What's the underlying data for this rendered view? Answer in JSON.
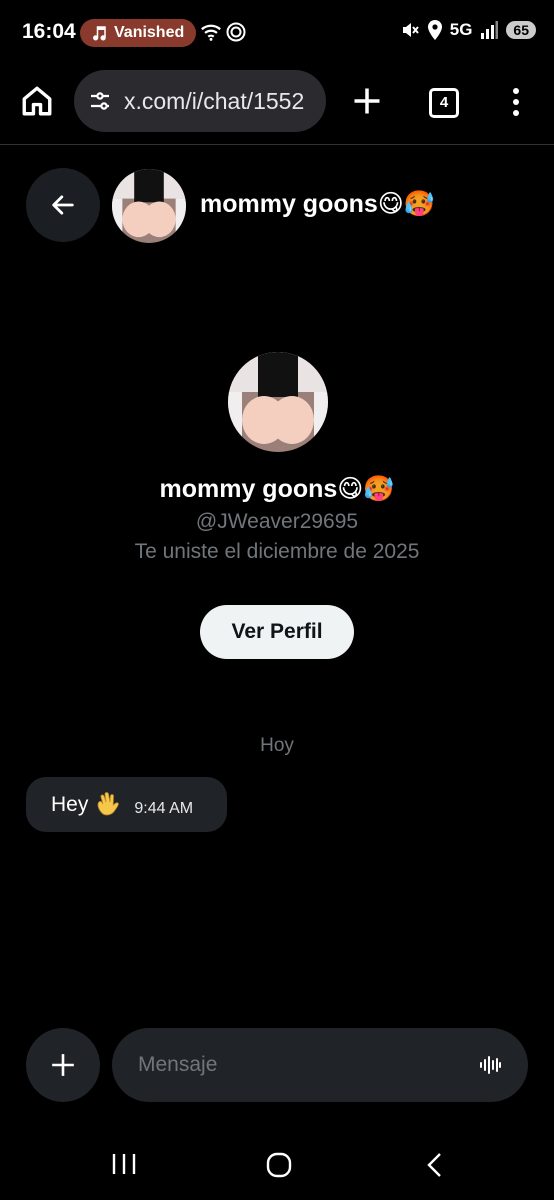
{
  "status_bar": {
    "time": "16:04",
    "vanished_label": "Vanished",
    "network": "5G",
    "battery": "65"
  },
  "browser": {
    "url": "x.com/i/chat/1552",
    "tab_count": "4"
  },
  "chat": {
    "title": "mommy goons😋🥵",
    "profile": {
      "name": "mommy goons😋🥵",
      "handle": "@JWeaver29695",
      "joined": "Te uniste el diciembre de 2025",
      "view_profile_label": "Ver Perfil"
    },
    "date_separator": "Hoy",
    "messages": [
      {
        "text": "Hey",
        "emoji_icon": "waving-hand-icon",
        "time": "9:44 AM",
        "direction": "incoming"
      }
    ],
    "composer": {
      "placeholder": "Mensaje"
    }
  },
  "colors": {
    "background": "#000000",
    "bubble": "#202327",
    "muted_text": "#71767b",
    "vanished_pill": "#8a3a2c",
    "button_light": "#eff3f4"
  }
}
